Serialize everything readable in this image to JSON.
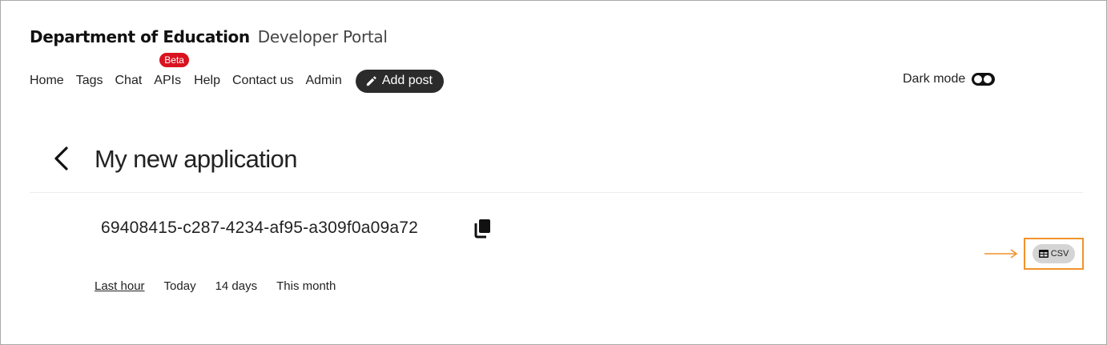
{
  "header": {
    "org_name": "Department of Education",
    "portal_name": "Developer Portal"
  },
  "nav": {
    "items": [
      {
        "label": "Home"
      },
      {
        "label": "Tags"
      },
      {
        "label": "Chat"
      },
      {
        "label": "APIs",
        "badge": "Beta"
      },
      {
        "label": "Help"
      },
      {
        "label": "Contact us"
      },
      {
        "label": "Admin"
      }
    ],
    "add_post": {
      "label": "Add post",
      "icon": "pencil-icon"
    }
  },
  "dark_mode": {
    "label": "Dark mode",
    "icon": "toggle-icon"
  },
  "page": {
    "title": "My new application",
    "back_icon": "chevron-left-icon",
    "app_id": "69408415-c287-4234-af95-a309f0a09a72",
    "copy_icon": "copy-icon"
  },
  "time_tabs": {
    "items": [
      "Last hour",
      "Today",
      "14 days",
      "This month"
    ],
    "active": "Last hour"
  },
  "export": {
    "csv_label": "CSV",
    "icon": "table-icon",
    "highlight_color": "#f0932b"
  },
  "colors": {
    "badge": "#d9121f",
    "button_dark": "#2b2b2b"
  }
}
